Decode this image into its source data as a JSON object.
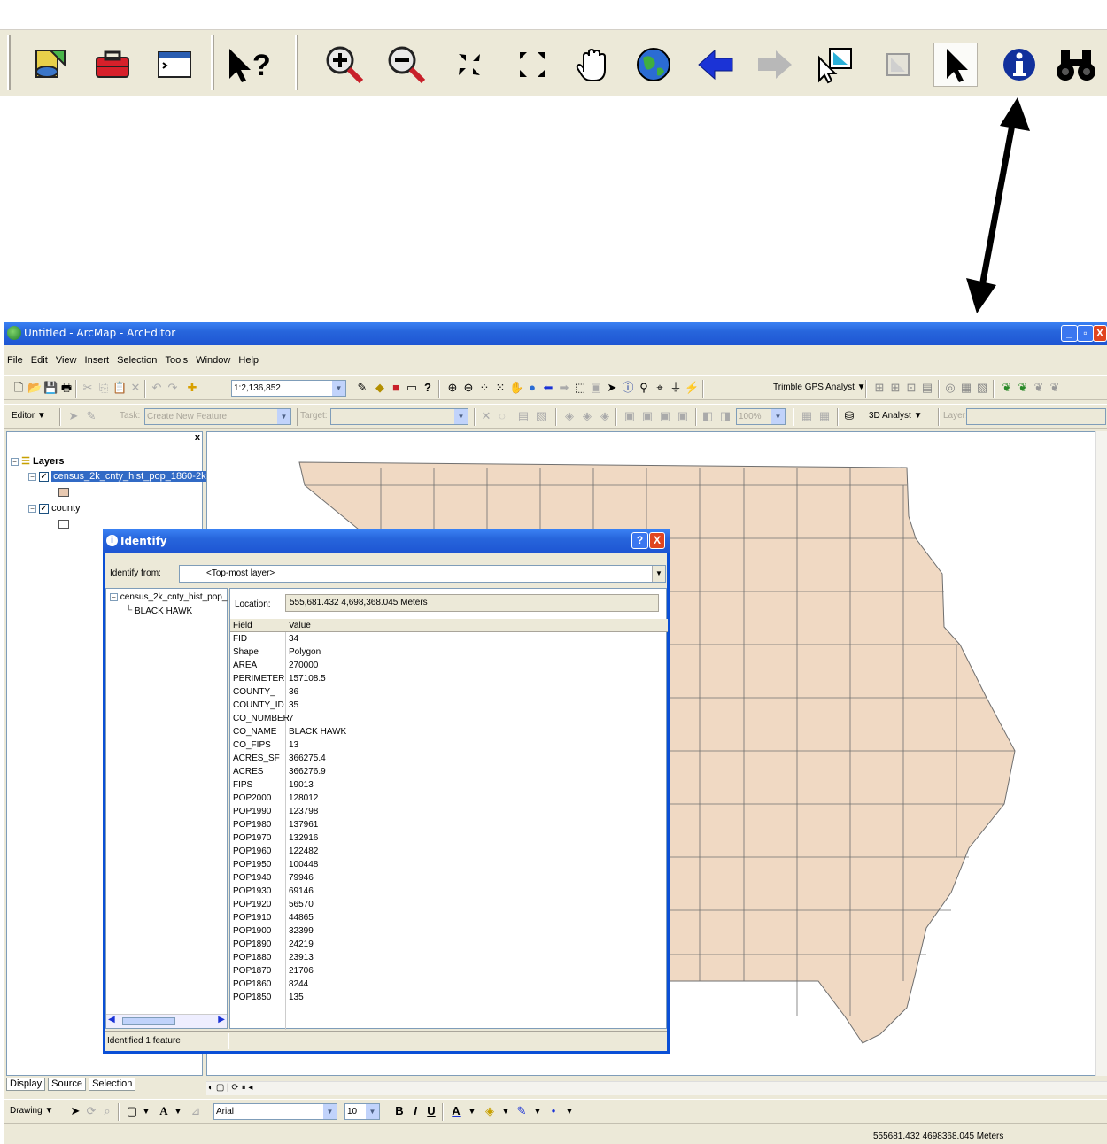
{
  "zoom_toolbar": {
    "icons": [
      "add-data-icon",
      "arctoolbox-icon",
      "command-line-icon",
      "whats-this-icon",
      "zoom-in-icon",
      "zoom-out-icon",
      "fixed-zoom-in-icon",
      "fixed-zoom-out-icon",
      "pan-icon",
      "full-extent-icon",
      "back-extent-icon",
      "forward-extent-icon",
      "select-features-icon",
      "clear-selection-icon",
      "select-elements-icon",
      "identify-icon",
      "find-icon"
    ],
    "whats_this": "?"
  },
  "window": {
    "title": "Untitled - ArcMap - ArcEditor",
    "minimize": "_",
    "maximize": "▫",
    "close": "X"
  },
  "menus": [
    "File",
    "Edit",
    "View",
    "Insert",
    "Selection",
    "Tools",
    "Window",
    "Help"
  ],
  "standard_toolbar": {
    "scale": "1:2,136,852",
    "trimble": "Trimble GPS Analyst ▼"
  },
  "editor_toolbar": {
    "editor": "Editor ▼",
    "task_label": "Task:",
    "task_value": "Create New Feature",
    "target_label": "Target:",
    "zoom_pct": "100%",
    "analyst3d": "3D Analyst ▼",
    "layer_label": "Layer:"
  },
  "toc": {
    "root": "Layers",
    "layers": [
      {
        "name": "census_2k_cnty_hist_pop_1860-2k",
        "selected": true,
        "fill": "#e8c9b1"
      },
      {
        "name": "county",
        "selected": false,
        "fill": "#ffffff"
      }
    ],
    "tabs": [
      "Display",
      "Source",
      "Selection"
    ]
  },
  "drawing_toolbar": {
    "drawing": "Drawing ▼",
    "font": "Arial",
    "size": "10",
    "bold": "B",
    "italic": "I",
    "underline": "U",
    "font_color": "A"
  },
  "status": {
    "coords": "555681.432  4698368.045 Meters"
  },
  "identify": {
    "title": "Identify",
    "help": "?",
    "close": "X",
    "from_label": "Identify from:",
    "from_value": "<Top-most layer>",
    "tree_layer": "census_2k_cnty_hist_pop_",
    "tree_feature": "BLACK HAWK",
    "location_label": "Location:",
    "location_value": "555,681.432  4,698,368.045 Meters",
    "col_field": "Field",
    "col_value": "Value",
    "rows": [
      [
        "FID",
        "34"
      ],
      [
        "Shape",
        "Polygon"
      ],
      [
        "AREA",
        "270000"
      ],
      [
        "PERIMETER",
        "157108.5"
      ],
      [
        "COUNTY_",
        "36"
      ],
      [
        "COUNTY_ID",
        "35"
      ],
      [
        "CO_NUMBER",
        "7"
      ],
      [
        "CO_NAME",
        "BLACK HAWK"
      ],
      [
        "CO_FIPS",
        "13"
      ],
      [
        "ACRES_SF",
        "366275.4"
      ],
      [
        "ACRES",
        "366276.9"
      ],
      [
        "FIPS",
        "19013"
      ],
      [
        "POP2000",
        "128012"
      ],
      [
        "POP1990",
        "123798"
      ],
      [
        "POP1980",
        "137961"
      ],
      [
        "POP1970",
        "132916"
      ],
      [
        "POP1960",
        "122482"
      ],
      [
        "POP1950",
        "100448"
      ],
      [
        "POP1940",
        "79946"
      ],
      [
        "POP1930",
        "69146"
      ],
      [
        "POP1920",
        "56570"
      ],
      [
        "POP1910",
        "44865"
      ],
      [
        "POP1900",
        "32399"
      ],
      [
        "POP1890",
        "24219"
      ],
      [
        "POP1880",
        "23913"
      ],
      [
        "POP1870",
        "21706"
      ],
      [
        "POP1860",
        "8244"
      ],
      [
        "POP1850",
        "135"
      ]
    ],
    "status": "Identified 1 feature"
  },
  "colors": {
    "county_fill": "#f0d9c3",
    "county_stroke": "#6f6f6f",
    "titlebar": "#2765dc",
    "highlight": "#316ac5"
  }
}
